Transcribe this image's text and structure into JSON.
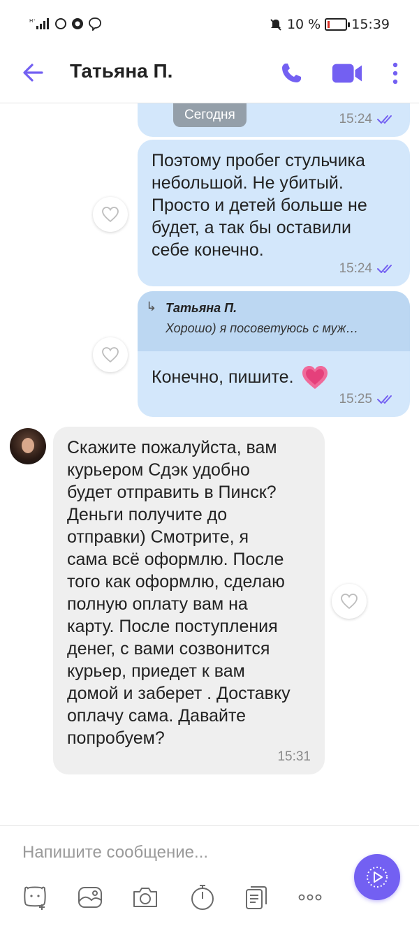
{
  "status_bar": {
    "battery": "10 %",
    "time": "15:39"
  },
  "header": {
    "title": "Татьяна П."
  },
  "chat": {
    "date_label": "Сегодня",
    "messages": [
      {
        "direction": "out",
        "text": "",
        "time": "15:24"
      },
      {
        "direction": "out",
        "text": "Поэтому пробег стульчика небольшой. Не убитый. Просто и детей больше не будет, а так бы оставили себе конечно.",
        "lines": [
          "Поэтому пробег стульчика",
          "небольшой. Не убитый.",
          "Просто и детей больше не",
          "будет, а так бы оставили",
          "себе конечно."
        ],
        "time": "15:24"
      },
      {
        "direction": "out",
        "reply_to": {
          "author": "Татьяна П.",
          "snippet": "Хорошо) я посоветуюсь с муж…"
        },
        "text": "Конечно, пишите.",
        "time": "15:25"
      },
      {
        "direction": "in",
        "lines": [
          "Скажите пожалуйста, вам",
          "курьером Сдэк удобно",
          "будет отправить в Пинск?",
          "Деньги получите до",
          "отправки) Смотрите, я",
          "сама всё оформлю. После",
          "того как оформлю, сделаю",
          "полную оплату вам на",
          "карту. После поступления",
          "денег, с вами созвонится",
          "курьер, приедет к вам",
          "домой и заберет . Доставку",
          "оплачу сама. Давайте",
          "попробуем?"
        ],
        "time": "15:31"
      }
    ]
  },
  "composer": {
    "placeholder": "Напишите сообщение..."
  },
  "colors": {
    "accent": "#7360f2",
    "outgoing_bubble": "#d3e7fb",
    "incoming_bubble": "#efefef"
  }
}
